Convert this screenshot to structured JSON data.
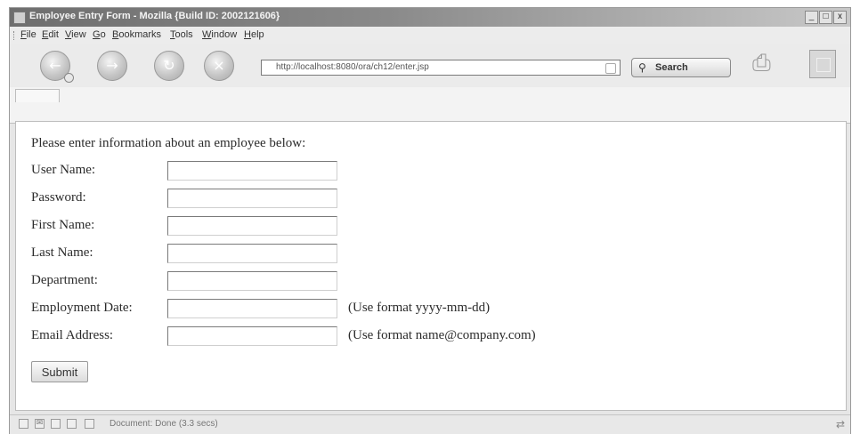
{
  "window": {
    "title": "Employee Entry Form - Mozilla {Build ID: 2002121606}",
    "minimize": "_",
    "maximize": "□",
    "close": "x"
  },
  "menu": [
    "File",
    "Edit",
    "View",
    "Go",
    "Bookmarks",
    "Tools",
    "Window",
    "Help"
  ],
  "toolbar": {
    "url": "http://localhost:8080/ora/ch12/enter.jsp",
    "search_label": "Search",
    "icons": {
      "back": "back-arrow-icon",
      "forward": "forward-arrow-icon",
      "reload": "reload-icon",
      "stop": "stop-icon",
      "print": "print-icon",
      "throbber": "mozilla-throbber-icon"
    }
  },
  "form": {
    "intro": "Please enter information about an employee below:",
    "fields": [
      {
        "label": "User Name:",
        "value": "",
        "hint": ""
      },
      {
        "label": "Password:",
        "value": "",
        "hint": ""
      },
      {
        "label": "First Name:",
        "value": "",
        "hint": ""
      },
      {
        "label": "Last Name:",
        "value": "",
        "hint": ""
      },
      {
        "label": "Department:",
        "value": "",
        "hint": ""
      },
      {
        "label": "Employment Date:",
        "value": "",
        "hint": "(Use format yyyy-mm-dd)"
      },
      {
        "label": "Email Address:",
        "value": "",
        "hint": "(Use format name@company.com)"
      }
    ],
    "submit_label": "Submit"
  },
  "status": {
    "text": "Document: Done (3.3 secs)"
  },
  "colors": {
    "titlebar_dark": "#6e6e6e",
    "chrome": "#ebebeb",
    "content_bg": "#ffffff"
  }
}
